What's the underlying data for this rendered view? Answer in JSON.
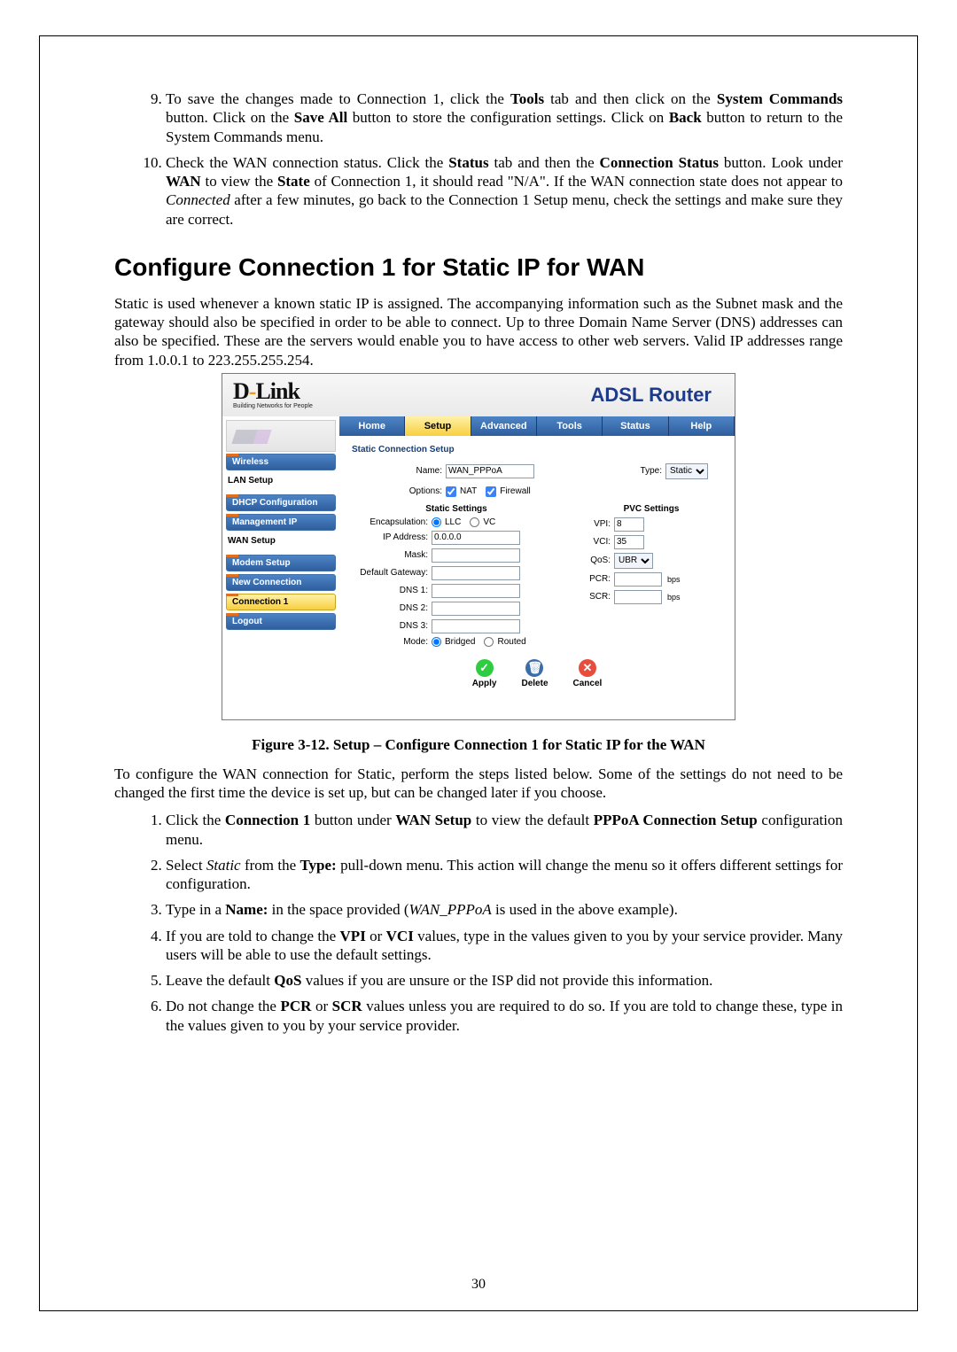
{
  "steps_a": {
    "s9": {
      "prefix": "To save the changes made to Connection 1, click the ",
      "b1": "Tools",
      "mid1": " tab and then click on the ",
      "b2": "System Commands",
      "mid2": " button. Click on the ",
      "b3": "Save All",
      "mid3": " button to store the configuration settings. Click on ",
      "b4": "Back",
      "suffix": " button to return to the System Commands menu."
    },
    "s10": {
      "prefix": "Check the WAN connection status. Click the ",
      "b1": "Status",
      "mid1": " tab and then the ",
      "b2": "Connection Status",
      "mid2": " button. Look under ",
      "b3": "WAN",
      "mid3": " to view the ",
      "b4": "State",
      "mid4": " of Connection 1, it should read  \"N/A\". If the WAN connection state does not appear to ",
      "i1": "Connected",
      "suffix": " after a few minutes, go back to the Connection 1 Setup menu, check the settings and make sure they are correct."
    }
  },
  "heading": "Configure Connection 1 for Static IP for WAN",
  "intro": "Static is used whenever a known static IP is assigned. The accompanying information such as the Subnet mask and the gateway should also be specified in order to be able to connect. Up to three Domain Name Server (DNS) addresses can also be specified. These are the servers would enable you to have access to other web servers. Valid IP addresses range from 1.0.0.1 to 223.255.255.254.",
  "caption": "Figure 3-12. Setup – Configure Connection 1 for Static IP for the WAN",
  "after_caption": "To configure the WAN connection for Static, perform the steps listed below. Some of the settings do not need to be changed the first time the device is set up, but can be changed later if you choose.",
  "steps_b": {
    "l1": {
      "a": "Click the ",
      "b1": "Connection 1",
      "c": " button under ",
      "b2": "WAN Setup",
      "d": " to view the default ",
      "b3": "PPPoA Connection Setup",
      "e": " configuration menu."
    },
    "l2": {
      "a": "Select ",
      "i1": "Static",
      "b": " from the ",
      "b1": "Type:",
      "c": " pull-down menu. This action will change the menu so it offers different settings for configuration."
    },
    "l3": {
      "a": "Type in a ",
      "b1": "Name:",
      "b": " in the space provided (",
      "i1": "WAN_PPPoA",
      "c": " is used in the above example)."
    },
    "l4": {
      "a": "If you are told to change the ",
      "b1": "VPI",
      "b": " or ",
      "b2": "VCI",
      "c": " values, type in the values given to you by your service provider. Many users will be able to use the default settings."
    },
    "l5": {
      "a": "Leave the default ",
      "b1": "QoS",
      "b": " values if you are unsure or the ISP did not provide this information."
    },
    "l6": {
      "a": "Do not change the ",
      "b1": "PCR",
      "b": " or ",
      "b2": "SCR",
      "c": " values unless you are required to do so. If you are told to change these, type in the values given to you by your service provider."
    }
  },
  "page_number": "30",
  "router": {
    "brand_main": "D-Link",
    "brand_sub": "Building Networks for People",
    "title": "ADSL Router",
    "tabs": {
      "home": "Home",
      "setup": "Setup",
      "advanced": "Advanced",
      "tools": "Tools",
      "status": "Status",
      "help": "Help"
    },
    "nav": {
      "wireless": "Wireless",
      "lan_setup": "LAN Setup",
      "dhcp": "DHCP Configuration",
      "mgmt": "Management IP",
      "wan_setup": "WAN Setup",
      "modem": "Modem Setup",
      "newconn": "New Connection",
      "conn1": "Connection 1",
      "logout": "Logout"
    },
    "section_title": "Static Connection Setup",
    "labels": {
      "name": "Name:",
      "type": "Type:",
      "options": "Options:",
      "nat": "NAT",
      "firewall": "Firewall",
      "static_settings": "Static Settings",
      "pvc_settings": "PVC Settings",
      "encap": "Encapsulation:",
      "llc": "LLC",
      "vc": "VC",
      "ip": "IP Address:",
      "mask": "Mask:",
      "gw": "Default Gateway:",
      "dns1": "DNS 1:",
      "dns2": "DNS 2:",
      "dns3": "DNS 3:",
      "mode": "Mode:",
      "bridged": "Bridged",
      "routed": "Routed",
      "vpi": "VPI:",
      "vci": "VCI:",
      "qos": "QoS:",
      "pcr": "PCR:",
      "scr": "SCR:",
      "bps": "bps",
      "apply": "Apply",
      "delete": "Delete",
      "cancel": "Cancel"
    },
    "values": {
      "name": "WAN_PPPoA",
      "type": "Static",
      "ip": "0.0.0.0",
      "vpi": "8",
      "vci": "35",
      "qos": "UBR"
    }
  }
}
